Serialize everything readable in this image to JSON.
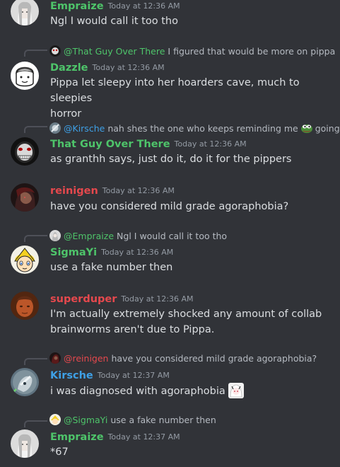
{
  "colors": {
    "background": "#313338",
    "text": "#dbdee1",
    "muted": "#949ba4",
    "green": "#4ec46a",
    "red": "#e5484d",
    "blue": "#3ea0e6"
  },
  "messages": [
    {
      "username": "Empraize",
      "color": "#4ec46a",
      "timestamp": "Today at 12:36 AM",
      "text": "Ngl I would call it too tho",
      "avatar": "empraize-avatar"
    },
    {
      "reply": {
        "name": "@That Guy Over There",
        "color": "#4ec46a",
        "text": "I figured that would be more on pippa"
      },
      "username": "Dazzle",
      "color": "#4ec46a",
      "timestamp": "Today at 12:36 AM",
      "text_lines": [
        "Pippa let sleepy into her hoarders cave, much to sleepies",
        "horror"
      ],
      "avatar": "dazzle-avatar"
    },
    {
      "reply": {
        "name": "@Kirsche",
        "color": "#3ea0e6",
        "text": "nah shes the one who keeps reminding me",
        "text2": "going ou"
      },
      "username": "That Guy Over There",
      "color": "#4ec46a",
      "timestamp": "Today at 12:36 AM",
      "text": "as granthh says, just do it, do it for the pippers",
      "avatar": "that-guy-avatar"
    },
    {
      "username": "reinigen",
      "color": "#e5484d",
      "timestamp": "Today at 12:36 AM",
      "text": "have you considered mild grade agoraphobia?",
      "avatar": "reinigen-avatar"
    },
    {
      "reply": {
        "name": "@Empraize",
        "color": "#4ec46a",
        "text": "Ngl I would call it too tho"
      },
      "username": "SigmaYi",
      "color": "#4ec46a",
      "timestamp": "Today at 12:36 AM",
      "text": "use a fake number then",
      "avatar": "sigmayi-avatar"
    },
    {
      "username": "superduper",
      "color": "#e5484d",
      "timestamp": "Today at 12:36 AM",
      "text_lines": [
        "I'm actually extremely shocked any amount of collab",
        "brainworms aren't due to Pippa."
      ],
      "avatar": "superduper-avatar"
    },
    {
      "reply": {
        "name": "@reinigen",
        "color": "#e5484d",
        "text": "have you considered mild grade agoraphobia?"
      },
      "username": "Kirsche",
      "color": "#3ea0e6",
      "timestamp": "Today at 12:37 AM",
      "text": "i was diagnosed with agoraphobia",
      "avatar": "kirsche-avatar"
    },
    {
      "reply": {
        "name": "@SigmaYi",
        "color": "#4ec46a",
        "text": "use a fake number then"
      },
      "username": "Empraize",
      "color": "#4ec46a",
      "timestamp": "Today at 12:37 AM",
      "text": "*67",
      "avatar": "empraize-avatar"
    }
  ]
}
